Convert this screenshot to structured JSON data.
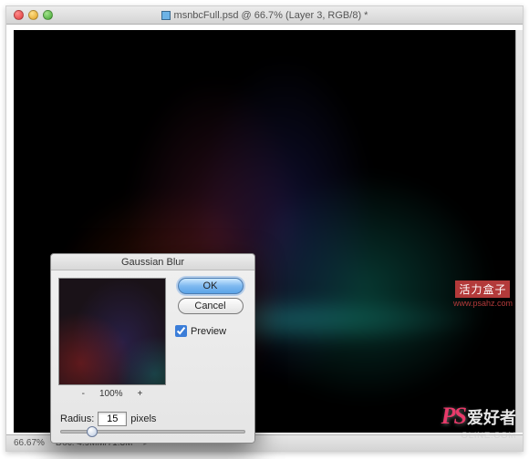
{
  "window": {
    "title": "msnbcFull.psd @ 66.7% (Layer 3, RGB/8) *"
  },
  "status": {
    "zoom": "66.67%",
    "doc": "Doc: 4.9MM/71.3M"
  },
  "dialog": {
    "title": "Gaussian Blur",
    "ok": "OK",
    "cancel": "Cancel",
    "preview_label": "Preview",
    "preview_checked": true,
    "zoom_minus": "-",
    "zoom_percent": "100%",
    "zoom_plus": "+",
    "radius_label": "Radius:",
    "radius_value": "15",
    "radius_unit": "pixels"
  },
  "watermark": {
    "ps": "PS",
    "cn": "爱好者",
    "sub": "OLINE.COM",
    "box": "活力盒子",
    "url": "www.psahz.com"
  }
}
